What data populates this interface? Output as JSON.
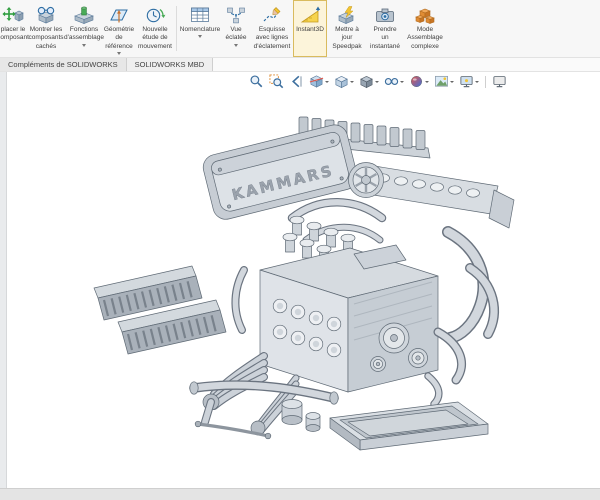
{
  "commandbar": {
    "buttons": [
      {
        "id": "move-component",
        "label": "placer le composant"
      },
      {
        "id": "show-hidden",
        "label": "Montrer les composants cachés"
      },
      {
        "id": "assembly-features",
        "label": "Fonctions d'assemblage",
        "has_dropdown": true
      },
      {
        "id": "reference-geometry",
        "label": "Géométrie de référence",
        "has_dropdown": true
      },
      {
        "id": "motion-study",
        "label": "Nouvelle étude de mouvement"
      },
      {
        "id": "bom",
        "label": "Nomenclature",
        "has_dropdown": true
      },
      {
        "id": "exploded-view",
        "label": "Vue éclatée",
        "has_dropdown": true
      },
      {
        "id": "explode-sketch",
        "label": "Esquisse avec lignes d'éclatement"
      },
      {
        "id": "instant3d",
        "label": "Instant3D",
        "selected": true
      },
      {
        "id": "speedpak",
        "label": "Mettre à jour Speedpak"
      },
      {
        "id": "snapshot",
        "label": "Prendre un instantané"
      },
      {
        "id": "large-assembly",
        "label": "Mode Assemblage complexe"
      }
    ]
  },
  "tabs": [
    {
      "label": "Compléments de SOLIDWORKS"
    },
    {
      "label": "SOLIDWORKS MBD"
    }
  ],
  "viewbar": {
    "icons": [
      "zoom-to-fit",
      "zoom-to-area",
      "previous-view",
      "section-view",
      "view-orientation",
      "display-style",
      "hide-show-items",
      "edit-appearance",
      "apply-scene",
      "view-settings",
      "screen"
    ]
  },
  "model": {
    "cover_text": "KAMMARS"
  },
  "colors": {
    "selected_highlight": "#fcf4da",
    "accent_green": "#2f9e3f",
    "accent_blue": "#2d6da3",
    "accent_orange": "#e08c34",
    "instant3d_yellow": "#f2c431",
    "model_gray": "#dce0e5"
  }
}
